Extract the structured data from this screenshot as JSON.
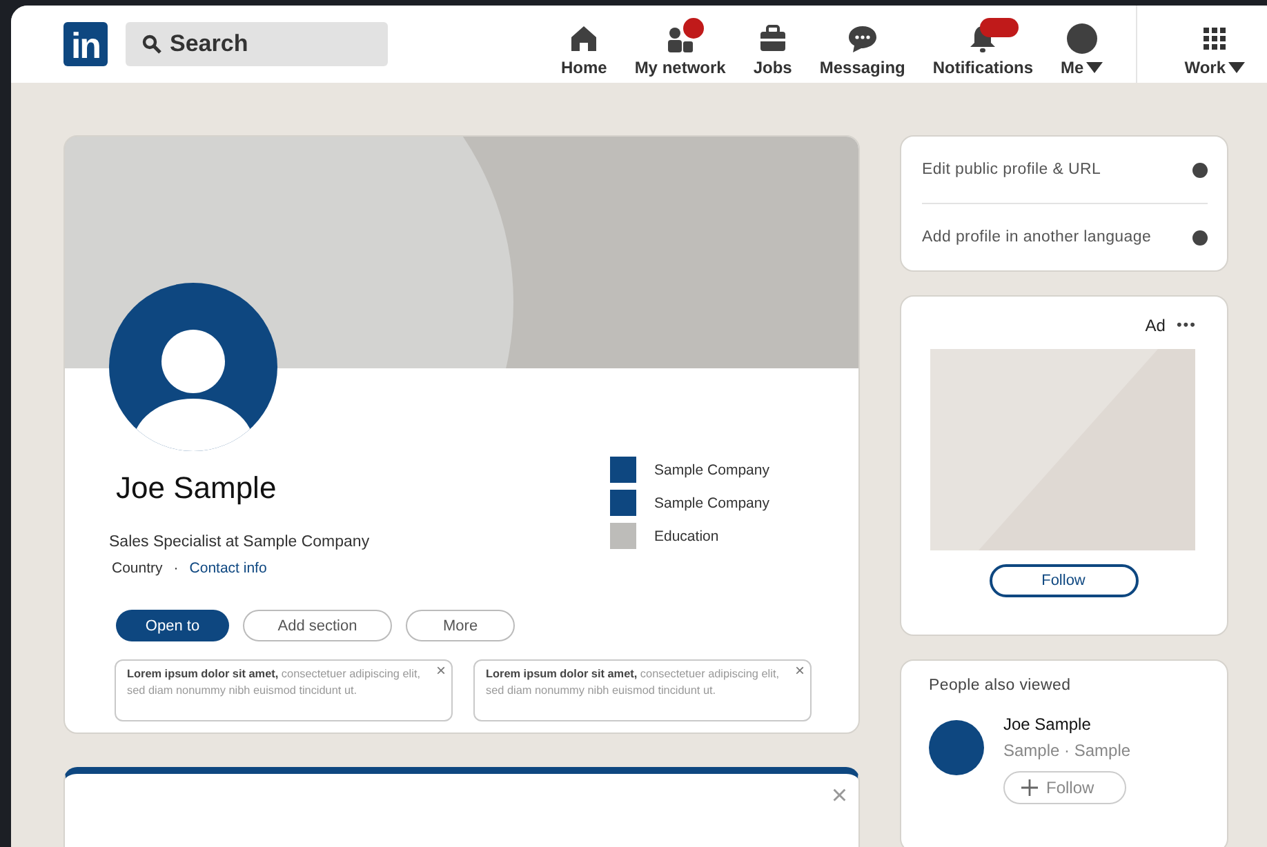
{
  "nav": {
    "logo": "in",
    "search": {
      "placeholder": "Search"
    },
    "items": [
      {
        "label": "Home",
        "badge": false,
        "caret": false
      },
      {
        "label": "My network",
        "badge": true,
        "caret": false
      },
      {
        "label": "Jobs",
        "badge": false,
        "caret": false
      },
      {
        "label": "Messaging",
        "badge": false,
        "caret": false
      },
      {
        "label": "Notifications",
        "badge": true,
        "caret": false
      },
      {
        "label": "Me",
        "badge": false,
        "caret": true
      }
    ],
    "work": {
      "label": "Work"
    }
  },
  "profile": {
    "name": "Joe Sample",
    "headline": "Sales Specialist at Sample Company",
    "location": "Country",
    "separator": "·",
    "contact_link": "Contact info",
    "experience": [
      {
        "label": "Sample Company",
        "color": "#0e4780"
      },
      {
        "label": "Sample Company",
        "color": "#0e4780"
      },
      {
        "label": "Education",
        "color": "#bdbcb9"
      }
    ],
    "buttons": [
      {
        "label": "Open to",
        "kind": "primary"
      },
      {
        "label": "Add section",
        "kind": "outline"
      },
      {
        "label": "More",
        "kind": "outline"
      }
    ],
    "notes": [
      {
        "text": "**Lorem ipsum dolor sit amet,** consectetuer adipiscing elit, sed diam nonummy nibh euismod tincidunt ut.",
        "close": "×"
      },
      {
        "text": "**Lorem ipsum dolor sit amet,** consectetuer adipiscing elit, sed diam nonummy nibh euismod tincidunt ut.",
        "close": "×"
      }
    ]
  },
  "second_card": {
    "close": "×"
  },
  "profile_links": [
    "Edit public profile & URL",
    "Add profile in another language"
  ],
  "ad": {
    "label": "Ad",
    "menu": "•••",
    "button": "Follow"
  },
  "people_also_viewed": {
    "title": "People also viewed",
    "people": [
      {
        "name": "Joe Sample",
        "subtitle": "Sample · Sample",
        "button": "Follow"
      }
    ]
  }
}
